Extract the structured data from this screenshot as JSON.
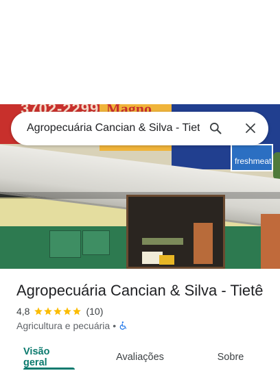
{
  "search": {
    "query": "Agropecuária Cancian & Silva - Tietê"
  },
  "photo": {
    "sign_number": "3702-2299",
    "sign_brand": "Magno",
    "sign_fresh": "freshmeat"
  },
  "place": {
    "title": "Agropecuária Cancian & Silva - Tietê",
    "rating": "4,8",
    "rating_stars": 5,
    "review_count": "(10)",
    "category": "Agricultura e pecuária",
    "separator": "•"
  },
  "tabs": [
    {
      "label": "Visão geral",
      "active": true
    },
    {
      "label": "Avaliações",
      "active": false
    },
    {
      "label": "Sobre",
      "active": false
    }
  ],
  "colors": {
    "accent": "#0b7a6e",
    "star": "#fbbc04",
    "accessible_icon": "#1a73e8"
  }
}
